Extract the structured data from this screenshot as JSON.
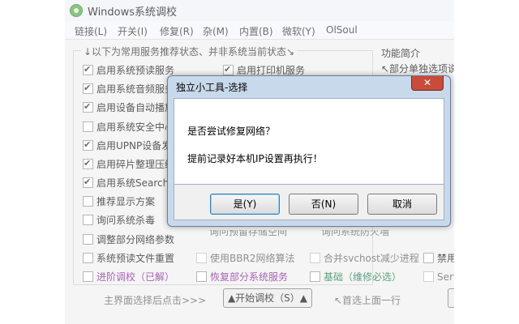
{
  "app": {
    "title": "Windows系统调校",
    "icon": "app-logo-icon"
  },
  "menu": [
    "链接(L)",
    "开关(I)",
    "修复(R)",
    "杂(M)",
    "内置(B)",
    "微软(Y)",
    "OlSoul"
  ],
  "group_legend": "↓以下为常用服务推荐状态、并非系统当前状态↘",
  "func_legend": "功能简介",
  "func_text": "↖部分单独选项说",
  "col1": [
    {
      "label": "启用系统预读服务",
      "checked": true
    },
    {
      "label": "启用系统音频服务",
      "checked": true
    },
    {
      "label": "启用设备自动播放",
      "checked": true
    },
    {
      "label": "启用系统安全中心",
      "checked": false
    },
    {
      "label": "启用UPNP设备发现",
      "checked": true
    },
    {
      "label": "启用碎片整理压缩",
      "checked": true
    },
    {
      "label": "启用系统Search服务",
      "checked": true
    },
    {
      "label": "推荐显示方案",
      "checked": false
    },
    {
      "label": "询问系统杀毒",
      "checked": false
    },
    {
      "label": "调整部分网络参数",
      "checked": false
    },
    {
      "label": "系统预读文件重置",
      "checked": false
    },
    {
      "label": "进阶调校（已解）",
      "checked": false
    }
  ],
  "col2_top": {
    "label": "启用打印机服务",
    "checked": true
  },
  "col2_partial": [
    "询问预留存储空间",
    "询问系统防火墙"
  ],
  "row_bbr": {
    "label": "使用BBR2网络算法",
    "checked": false
  },
  "row_svchost": {
    "label": "合并svchost减少进程",
    "checked": false
  },
  "row_disable": {
    "label": "禁用",
    "checked": false
  },
  "row_restore": {
    "label": "恢复部分系统服务",
    "checked": false
  },
  "row_basic": {
    "label": "基础（维修必选）",
    "checked": false
  },
  "row_serv": {
    "label": "Serv",
    "checked": false
  },
  "bottom": {
    "left_text": "主界面选择后点击>>>",
    "start_button": "▲开始调校（S）▲",
    "right_text": "↖首选上面一行"
  },
  "dialog": {
    "title": "独立小工具-选择",
    "close": "✕",
    "message1": "是否尝试修复网络？",
    "message2": "提前记录好本机IP设置再执行！",
    "yes": "是(Y)",
    "no": "否(N)",
    "cancel": "取消"
  }
}
